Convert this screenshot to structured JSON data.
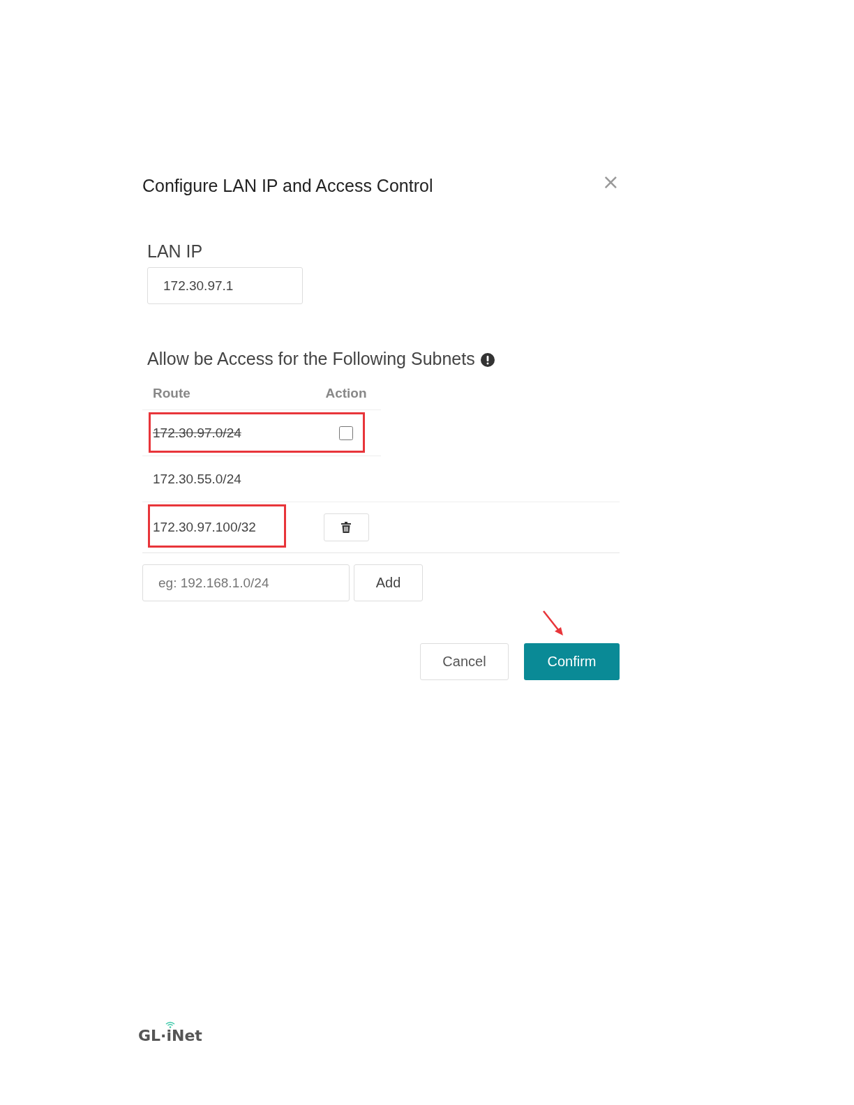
{
  "dialog": {
    "title": "Configure LAN IP and Access Control",
    "close": "×"
  },
  "lan_ip": {
    "label": "LAN IP",
    "value": "172.30.97.1"
  },
  "subnets": {
    "heading": "Allow be Access for the Following Subnets",
    "columns": [
      "Route",
      "Action"
    ],
    "rows": [
      {
        "route": "172.30.97.0/24",
        "kind": "checkbox",
        "struck": true,
        "checked": false,
        "row_boxed": true,
        "route_boxed": false
      },
      {
        "route": "172.30.55.0/24",
        "kind": "plain",
        "struck": false,
        "row_boxed": false,
        "route_boxed": false
      },
      {
        "route": "172.30.97.100/32",
        "kind": "delete",
        "struck": false,
        "row_boxed": false,
        "route_boxed": true
      }
    ],
    "new_route": {
      "placeholder": "eg: 192.168.1.0/24"
    },
    "add_button": "Add"
  },
  "buttons": [
    {
      "label": "Cancel",
      "kind": "secondary"
    },
    {
      "label": "Confirm",
      "kind": "primary",
      "pointed": true
    }
  ],
  "footer": {
    "logo": "GL·iNet"
  }
}
